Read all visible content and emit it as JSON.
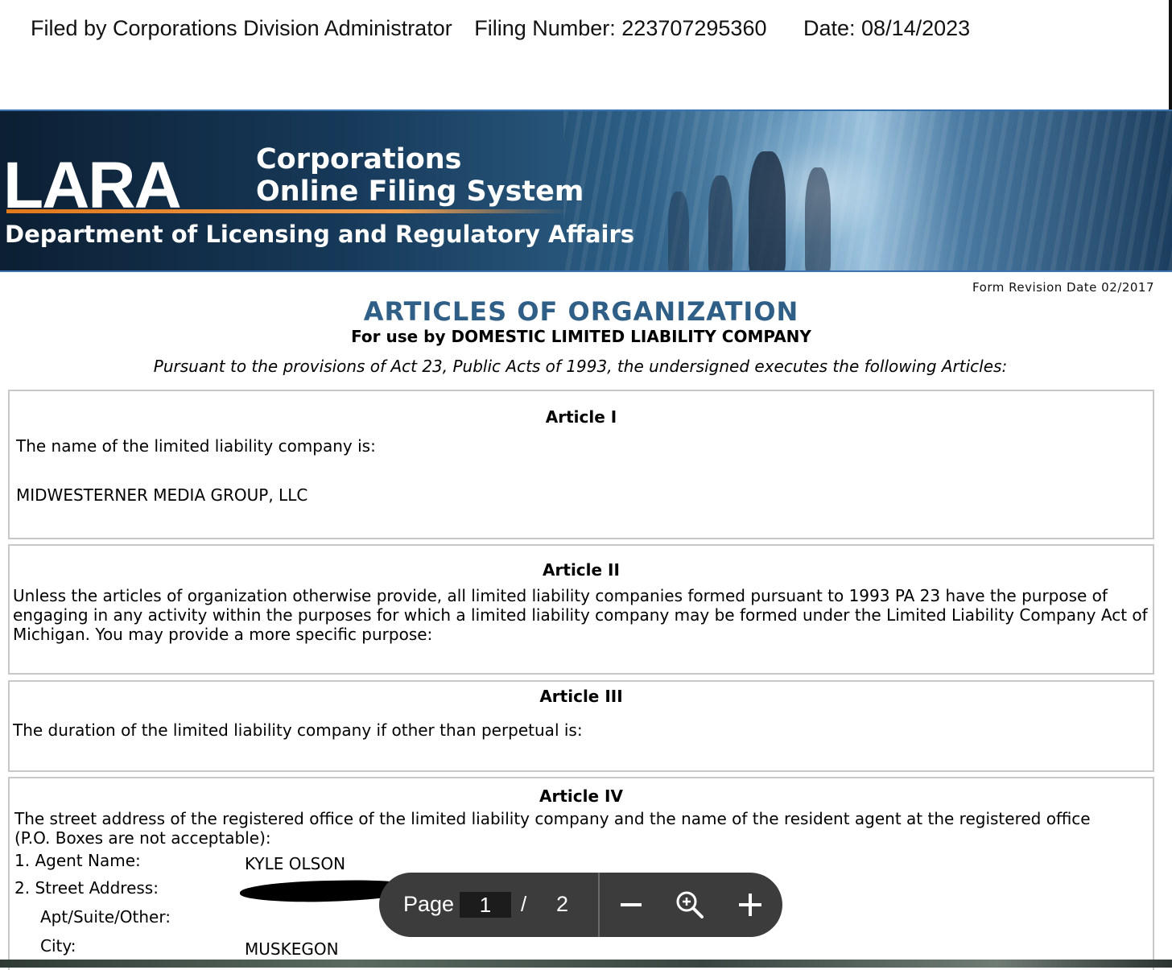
{
  "filing_header": {
    "filed_by": "Filed by Corporations Division Administrator",
    "filing_number": "Filing Number: 223707295360",
    "date": "Date: 08/14/2023"
  },
  "banner": {
    "logo": "LARA",
    "system_line1": "Corporations",
    "system_line2": "Online Filing System",
    "department": "Department of Licensing and Regulatory Affairs"
  },
  "form": {
    "revision": "Form Revision Date 02/2017",
    "title": "ARTICLES OF ORGANIZATION",
    "subtitle": "For use by DOMESTIC LIMITED LIABILITY COMPANY",
    "pursuant": "Pursuant to the provisions of Act 23, Public Acts of 1993, the undersigned executes the following Articles:"
  },
  "articles": {
    "a1": {
      "heading": "Article I",
      "text": "The name of the limited liability company is:",
      "value": "MIDWESTERNER MEDIA GROUP, LLC"
    },
    "a2": {
      "heading": "Article II",
      "line1": "Unless the articles of organization otherwise provide, all limited liability companies formed pursuant to 1993 PA 23 have the purpose of",
      "line2": "engaging in any activity within the purposes for which a limited liability company may be formed under the Limited Liability Company Act of",
      "line3": "Michigan. You may provide a more specific purpose:"
    },
    "a3": {
      "heading": "Article III",
      "text": "The duration of the limited liability company if other than perpetual is:"
    },
    "a4": {
      "heading": "Article IV",
      "line1": "The street address of the registered office of the limited liability company and the name of the resident agent at the registered office",
      "line2": "(P.O. Boxes are not acceptable):",
      "agent_label": "1.  Agent Name:",
      "agent_value": "KYLE OLSON",
      "street_label": "2. Street Address:",
      "apt_label": "Apt/Suite/Other:",
      "city_label": "City:",
      "city_value": "MUSKEGON"
    }
  },
  "viewer": {
    "page_label": "Page",
    "current_page": "1",
    "separator": "/",
    "total_pages": "2",
    "icons": [
      "minus-icon",
      "zoom-icon",
      "plus-icon"
    ]
  }
}
